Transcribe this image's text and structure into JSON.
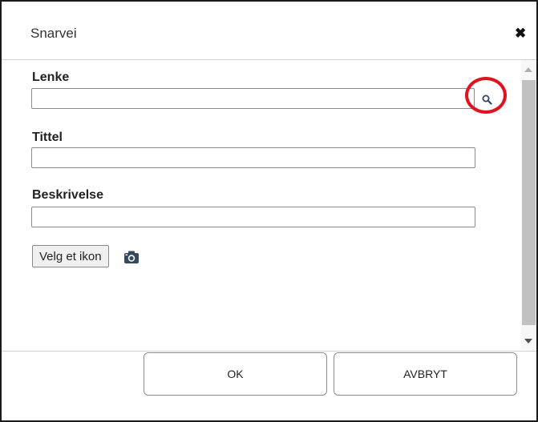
{
  "dialog": {
    "title": "Snarvei",
    "close_glyph": "✖",
    "close_icon": "close-icon"
  },
  "form": {
    "link_label": "Lenke",
    "link_value": "",
    "link_search_icon": "search-icon",
    "title_label": "Tittel",
    "title_value": "",
    "description_label": "Beskrivelse",
    "description_value": "",
    "choose_icon_label": "Velg et ikon",
    "choose_icon_icon": "camera-icon"
  },
  "footer": {
    "ok_label": "OK",
    "cancel_label": "AVBRYT"
  },
  "colors": {
    "highlight": "#e0141e",
    "icon": "#34495e"
  }
}
